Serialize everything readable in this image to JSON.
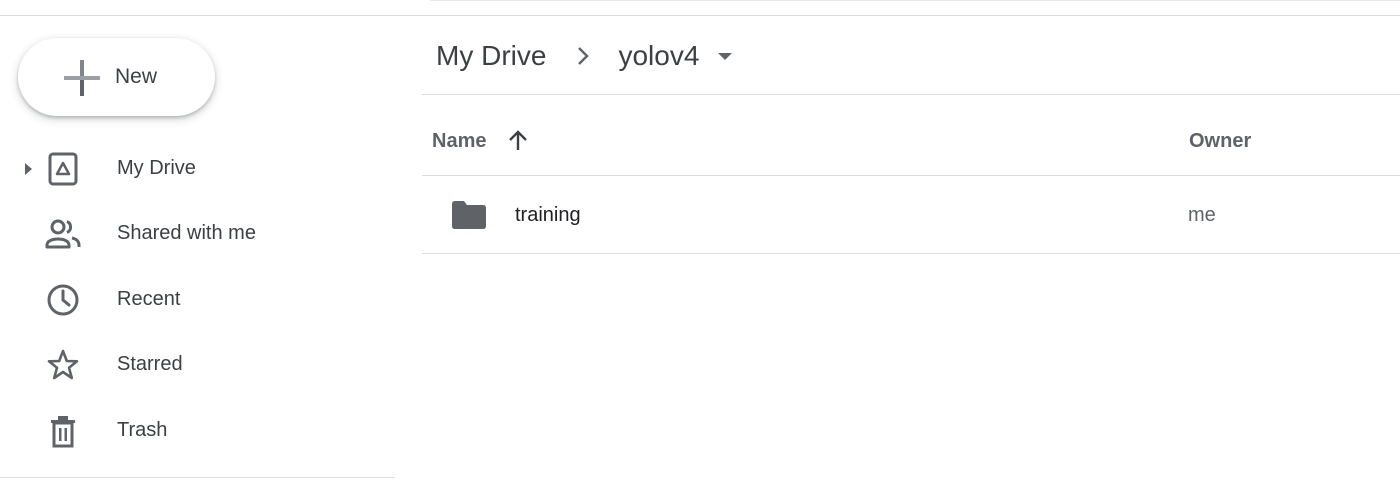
{
  "sidebar": {
    "new_label": "New",
    "items": [
      {
        "label": "My Drive",
        "icon": "my-drive-icon",
        "expandable": true
      },
      {
        "label": "Shared with me",
        "icon": "shared-people-icon"
      },
      {
        "label": "Recent",
        "icon": "clock-icon"
      },
      {
        "label": "Starred",
        "icon": "star-icon"
      },
      {
        "label": "Trash",
        "icon": "trash-icon"
      }
    ]
  },
  "breadcrumb": {
    "root": "My Drive",
    "current": "yolov4"
  },
  "table": {
    "columns": {
      "name": "Name",
      "owner": "Owner"
    },
    "sort": "ascending",
    "rows": [
      {
        "name": "training",
        "owner": "me",
        "type": "folder-icon"
      }
    ]
  },
  "colors": {
    "text": "#3c4043",
    "muted": "#5f6368",
    "divider": "#dadce0",
    "folder": "#5f6368"
  }
}
